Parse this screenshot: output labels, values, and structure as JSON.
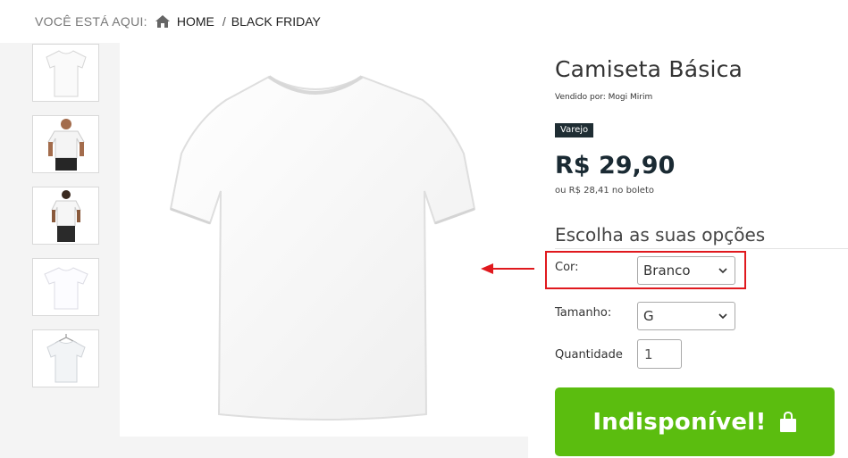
{
  "breadcrumb": {
    "prefix": "VOCÊ ESTÁ AQUI:",
    "home_icon": "home-icon",
    "items": [
      {
        "label": "HOME"
      },
      {
        "label": "BLACK FRIDAY"
      }
    ],
    "separator": "/"
  },
  "gallery": {
    "thumbnails": [
      {
        "icon": "white-tshirt-flat"
      },
      {
        "icon": "model-front"
      },
      {
        "icon": "model-back"
      },
      {
        "icon": "white-tshirt-plain"
      },
      {
        "icon": "white-tshirt-hanger"
      }
    ],
    "main_image": "white-tshirt"
  },
  "product": {
    "title": "Camiseta Básica",
    "seller": "Vendido por:  Mogi Mirim",
    "badge": "Varejo",
    "price": "R$ 29,90",
    "boleto": "ou R$ 28,41 no boleto"
  },
  "options": {
    "heading": "Escolha as suas opções",
    "color": {
      "label": "Cor:",
      "value": "Branco"
    },
    "size": {
      "label": "Tamanho:",
      "value": "G"
    },
    "quantity": {
      "label": "Quantidade",
      "value": "1"
    }
  },
  "buy_button": {
    "label": "Indisponível!",
    "color": "#5bbd0f",
    "icon": "shopping-bag-icon"
  },
  "annotation": {
    "color": "#e0191e"
  }
}
